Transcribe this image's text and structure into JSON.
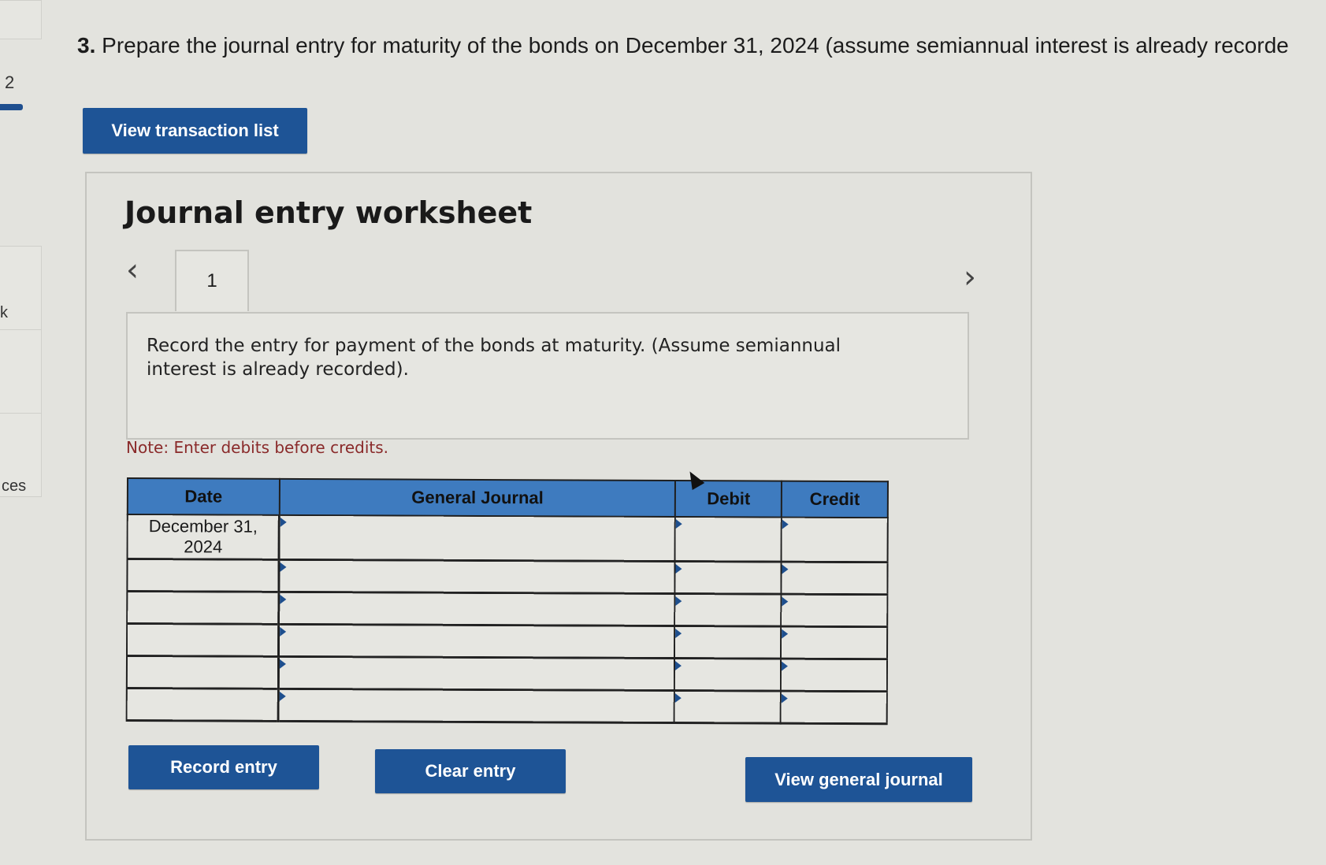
{
  "left_rail": {
    "number": "2",
    "partial_glyph": "k",
    "partial_label": "ces"
  },
  "question": {
    "number": "3.",
    "text": "Prepare the journal entry for maturity of the bonds on December 31, 2024 (assume semiannual interest is already recorde"
  },
  "buttons": {
    "view_transaction_list": "View transaction list",
    "record_entry": "Record entry",
    "clear_entry": "Clear entry",
    "view_general_journal": "View general journal"
  },
  "worksheet": {
    "title": "Journal entry worksheet",
    "prev_icon": "‹",
    "next_icon": "›",
    "tabs": [
      {
        "label": "1"
      }
    ],
    "instruction": "Record the entry for payment of the bonds at maturity. (Assume semiannual interest is already recorded).",
    "note": "Note: Enter debits before credits."
  },
  "journal_table": {
    "headers": {
      "date": "Date",
      "general_journal": "General Journal",
      "debit": "Debit",
      "credit": "Credit"
    },
    "rows": [
      {
        "date": "December 31, 2024",
        "account": "",
        "debit": "",
        "credit": ""
      },
      {
        "date": "",
        "account": "",
        "debit": "",
        "credit": ""
      },
      {
        "date": "",
        "account": "",
        "debit": "",
        "credit": ""
      },
      {
        "date": "",
        "account": "",
        "debit": "",
        "credit": ""
      },
      {
        "date": "",
        "account": "",
        "debit": "",
        "credit": ""
      },
      {
        "date": "",
        "account": "",
        "debit": "",
        "credit": ""
      }
    ]
  },
  "colors": {
    "button_blue": "#1e5496",
    "header_blue": "#3e7bbf",
    "note_red": "#8a2a2a"
  }
}
